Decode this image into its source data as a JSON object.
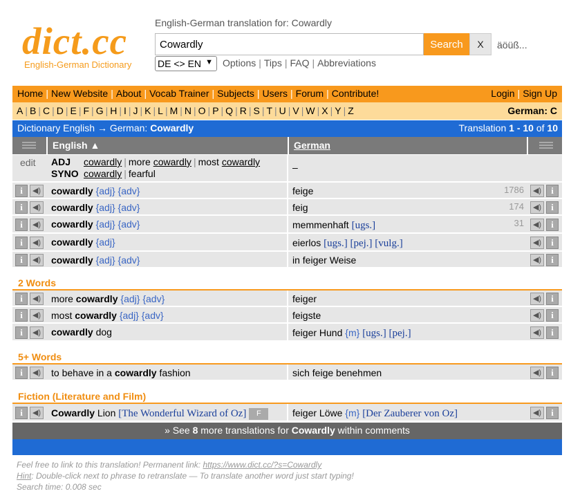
{
  "header": {
    "logo": "dict.cc",
    "logo_subtitle": "English-German Dictionary",
    "title": "English-German translation for: Cowardly",
    "search_value": "Cowardly",
    "search_button": "Search",
    "clear_button": "X",
    "special_chars": "äöüß...",
    "lang_select": "DE <> EN",
    "links": [
      "Options",
      "Tips",
      "FAQ",
      "Abbreviations"
    ]
  },
  "nav": {
    "left": [
      "Home",
      "New Website",
      "About",
      "Vocab Trainer",
      "Subjects",
      "Users",
      "Forum",
      "Contribute!"
    ],
    "right": [
      "Login",
      "Sign Up"
    ]
  },
  "letters": [
    "A",
    "B",
    "C",
    "D",
    "E",
    "F",
    "G",
    "H",
    "I",
    "J",
    "K",
    "L",
    "M",
    "N",
    "O",
    "P",
    "Q",
    "R",
    "S",
    "T",
    "U",
    "V",
    "W",
    "X",
    "Y",
    "Z"
  ],
  "letters_label": "German: C",
  "dict_bar": {
    "left_prefix": "Dictionary English → German:",
    "left_word": "Cowardly",
    "right_prefix": "Translation",
    "right_range": "1 - 10",
    "right_of": "of",
    "right_total": "10"
  },
  "columns": {
    "english": "English ▲",
    "german": "German"
  },
  "synonyms": {
    "edit": "edit",
    "adj_label": "ADJ",
    "adj_items": [
      "cowardly",
      "more cowardly",
      "most cowardly"
    ],
    "syno_label": "SYNO",
    "syno_items": [
      "cowardly",
      "fearful"
    ],
    "german": "–"
  },
  "sections": {
    "two_words": "2 Words",
    "five_plus": "5+ Words",
    "fiction": "Fiction (Literature and Film)"
  },
  "entries": {
    "e1": {
      "en_word": "cowardly",
      "en_tags": "{adj} {adv}",
      "de": "feige",
      "count": "1786"
    },
    "e2": {
      "en_word": "cowardly",
      "en_tags": "{adj} {adv}",
      "de": "feig",
      "count": "174"
    },
    "e3": {
      "en_word": "cowardly",
      "en_tags": "{adj} {adv}",
      "de": "memmenhaft",
      "de_ref": "[ugs.]",
      "count": "31"
    },
    "e4": {
      "en_word": "cowardly",
      "en_tags": "{adj}",
      "de": "eierlos",
      "de_ref": "[ugs.] [pej.] [vulg.]"
    },
    "e5": {
      "en_word": "cowardly",
      "en_tags": "{adj} {adv}",
      "de": "in feiger Weise"
    },
    "w1": {
      "en_pre": "more",
      "en_word": "cowardly",
      "en_tags": "{adj} {adv}",
      "de": "feiger"
    },
    "w2": {
      "en_pre": "most",
      "en_word": "cowardly",
      "en_tags": "{adj} {adv}",
      "de": "feigste"
    },
    "w3": {
      "en_word": "cowardly",
      "en_post": "dog",
      "de": "feiger Hund",
      "de_tag": "{m}",
      "de_ref": "[ugs.] [pej.]"
    },
    "f1": {
      "en_pre": "to behave in a",
      "en_word": "cowardly",
      "en_post": "fashion",
      "de": "sich feige benehmen"
    },
    "l1": {
      "en_word": "Cowardly",
      "en_post": "Lion",
      "en_ref": "[The Wonderful Wizard of Oz]",
      "en_badge": "F",
      "de": "feiger Löwe",
      "de_tag": "{m}",
      "de_ref": "[Der Zauberer von Oz]"
    }
  },
  "more": {
    "prefix": "» See",
    "count": "8",
    "middle": "more translations for",
    "word": "Cowardly",
    "suffix": "within comments"
  },
  "footer": {
    "line1_prefix": "Feel free to link to this translation! Permanent link:",
    "line1_link": "https://www.dict.cc/?s=Cowardly",
    "line2_hint": "Hint",
    "line2_text": ": Double-click next to phrase to retranslate — To translate another word just start typing!",
    "line3": "Search time: 0.008 sec"
  },
  "icons": {
    "info": "info-icon",
    "speaker": "speaker-icon",
    "menu": "menu-icon"
  },
  "colors": {
    "orange": "#f8991d",
    "blue": "#1f6bd4",
    "grey_header": "#7a7a7a"
  }
}
